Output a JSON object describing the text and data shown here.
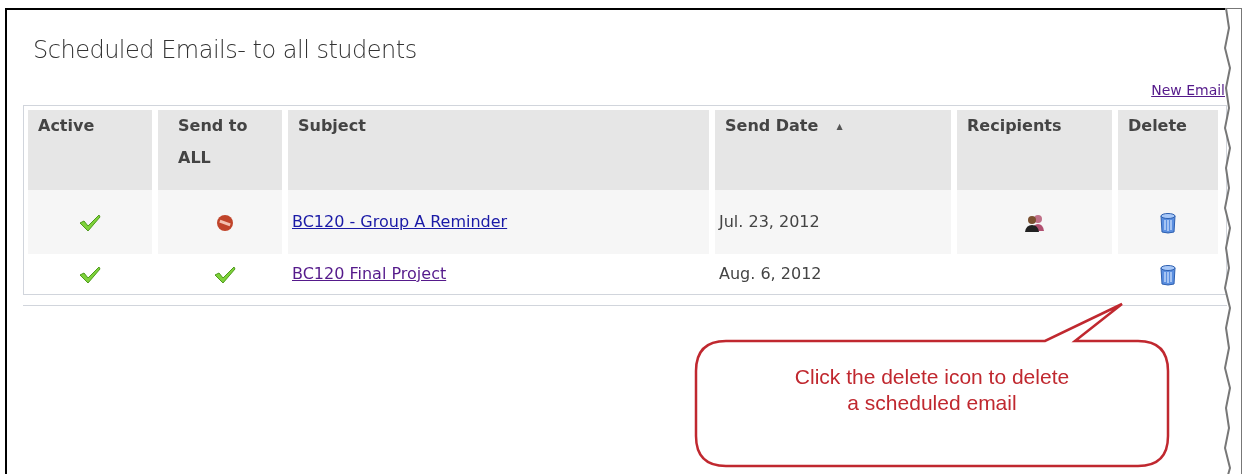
{
  "panel": {
    "title": "Scheduled Emails- to all students",
    "new_email_link": "New Email"
  },
  "table": {
    "columns": [
      {
        "label": "Active"
      },
      {
        "label": "Send to ALL"
      },
      {
        "label": "Subject"
      },
      {
        "label": "Send Date",
        "sort_mark": "▲"
      },
      {
        "label": "Recipients"
      },
      {
        "label": "Delete"
      }
    ],
    "rows": [
      {
        "active": true,
        "send_to_all": false,
        "subject": "BC120 - Group A Reminder",
        "visited": false,
        "send_date": "Jul. 23, 2012",
        "has_recipients": true
      },
      {
        "active": true,
        "send_to_all": true,
        "subject": "BC120 Final Project",
        "visited": true,
        "send_date": "Aug. 6, 2012",
        "has_recipients": false
      }
    ]
  },
  "callout": {
    "text": "Click the delete icon to delete a scheduled email"
  }
}
